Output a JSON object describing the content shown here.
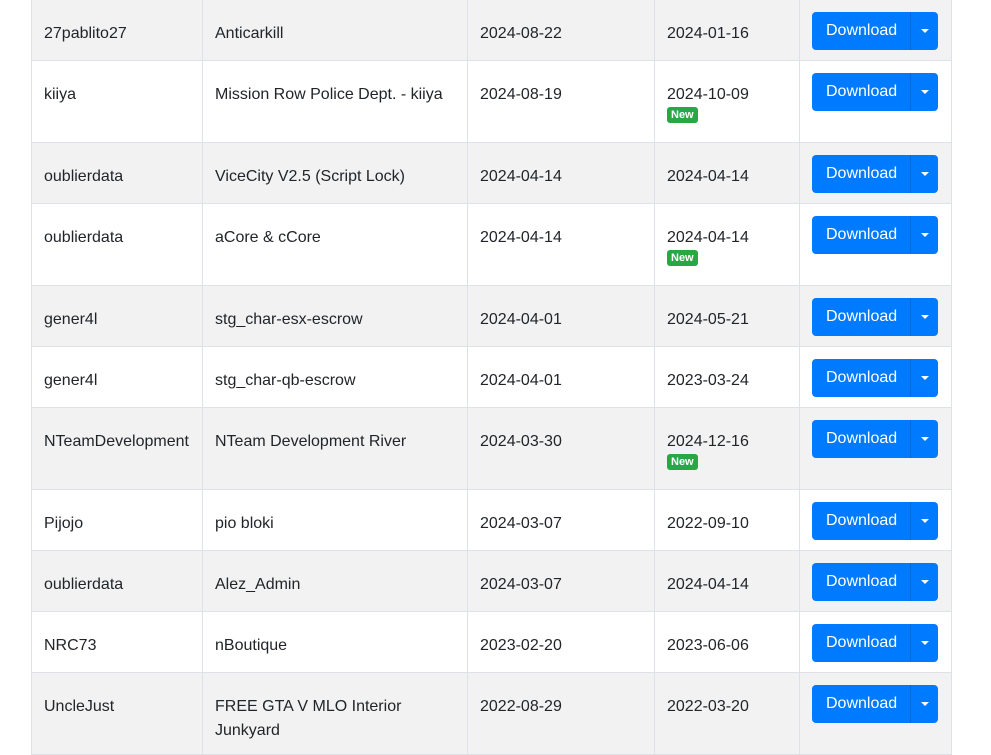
{
  "table": {
    "rows": [
      {
        "author": "27pablito27",
        "name": "Anticarkill",
        "uploaded": "2024-08-22",
        "updated": "2024-01-16",
        "badge": "",
        "button": "Download"
      },
      {
        "author": "kiiya",
        "name": "Mission Row Police Dept. - kiiya",
        "uploaded": "2024-08-19",
        "updated": "2024-10-09",
        "badge": "New",
        "button": "Download"
      },
      {
        "author": "oublierdata",
        "name": "ViceCity V2.5 (Script Lock)",
        "uploaded": "2024-04-14",
        "updated": "2024-04-14",
        "badge": "",
        "button": "Download"
      },
      {
        "author": "oublierdata",
        "name": "aCore & cCore",
        "uploaded": "2024-04-14",
        "updated": "2024-04-14",
        "badge": "New",
        "button": "Download"
      },
      {
        "author": "gener4l",
        "name": "stg_char-esx-escrow",
        "uploaded": "2024-04-01",
        "updated": "2024-05-21",
        "badge": "",
        "button": "Download"
      },
      {
        "author": "gener4l",
        "name": "stg_char-qb-escrow",
        "uploaded": "2024-04-01",
        "updated": "2023-03-24",
        "badge": "",
        "button": "Download"
      },
      {
        "author": "NTeamDevelopment",
        "name": "NTeam Development River",
        "uploaded": "2024-03-30",
        "updated": "2024-12-16",
        "badge": "New",
        "button": "Download"
      },
      {
        "author": "Pijojo",
        "name": "pio bloki",
        "uploaded": "2024-03-07",
        "updated": "2022-09-10",
        "badge": "",
        "button": "Download"
      },
      {
        "author": "oublierdata",
        "name": "Alez_Admin",
        "uploaded": "2024-03-07",
        "updated": "2024-04-14",
        "badge": "",
        "button": "Download"
      },
      {
        "author": "NRC73",
        "name": "nBoutique",
        "uploaded": "2023-02-20",
        "updated": "2023-06-06",
        "badge": "",
        "button": "Download"
      },
      {
        "author": "UncleJust",
        "name": "FREE GTA V MLO Interior Junkyard",
        "uploaded": "2022-08-29",
        "updated": "2022-03-20",
        "badge": "",
        "button": "Download"
      }
    ]
  },
  "colors": {
    "primary": "#007bff",
    "badge_green": "#28a745",
    "stripe": "#f2f2f2",
    "border": "#dee2e6"
  }
}
